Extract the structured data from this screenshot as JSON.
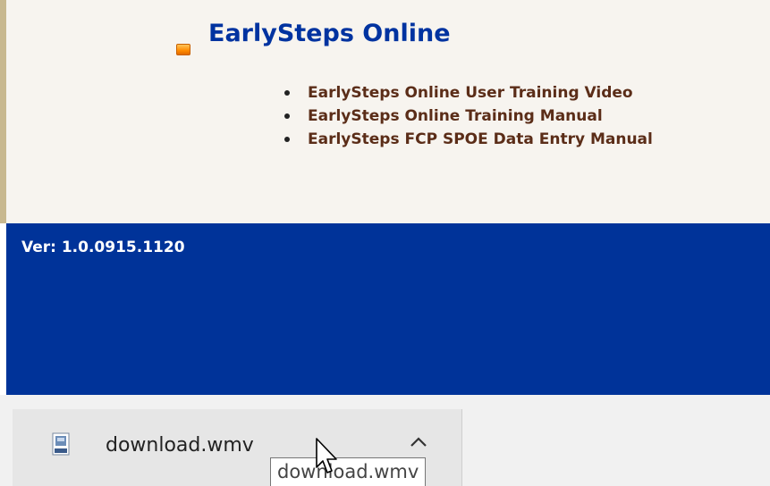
{
  "section": {
    "title": "EarlySteps Online",
    "bullet_icon": "orange-square-bullet-icon",
    "links": [
      {
        "label": "EarlySteps Online User Training Video"
      },
      {
        "label": "EarlySteps Online Training Manual"
      },
      {
        "label": "EarlySteps FCP SPOE Data Entry Manual"
      }
    ]
  },
  "footer": {
    "version": "Ver: 1.0.0915.1120"
  },
  "download_bar": {
    "file_name": "download.wmv",
    "file_icon": "wmv-file-icon",
    "menu_icon": "chevron-up-icon",
    "tooltip": "download.wmv"
  },
  "colors": {
    "title_blue": "#0033a0",
    "link_brown": "#5b2d18",
    "footer_blue": "#003399",
    "content_bg": "#f7f4ef"
  }
}
